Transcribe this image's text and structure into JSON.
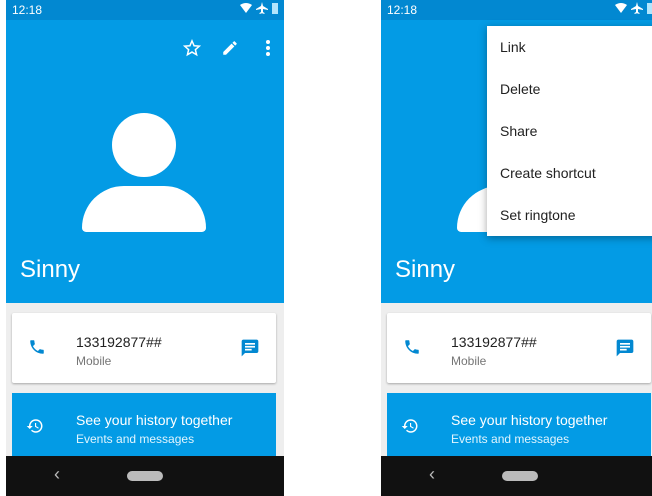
{
  "status": {
    "time": "12:18"
  },
  "contact": {
    "name": "Sinny"
  },
  "phone_entry": {
    "number": "133192877##",
    "type": "Mobile"
  },
  "history": {
    "title": "See your history together",
    "subtitle": "Events and messages"
  },
  "nav": {
    "back_glyph": "‹"
  },
  "overflow_menu": {
    "items": [
      {
        "label": "Link"
      },
      {
        "label": "Delete"
      },
      {
        "label": "Share"
      },
      {
        "label": "Create shortcut"
      },
      {
        "label": "Set ringtone"
      }
    ]
  },
  "colors": {
    "primary": "#039be5",
    "status_bar": "#0288d1",
    "nav_bar": "#111111"
  },
  "icons": [
    "wifi-icon",
    "airplane-icon",
    "battery-icon",
    "star-icon",
    "edit-icon",
    "more-icon",
    "phone-icon",
    "message-icon",
    "history-icon"
  ]
}
